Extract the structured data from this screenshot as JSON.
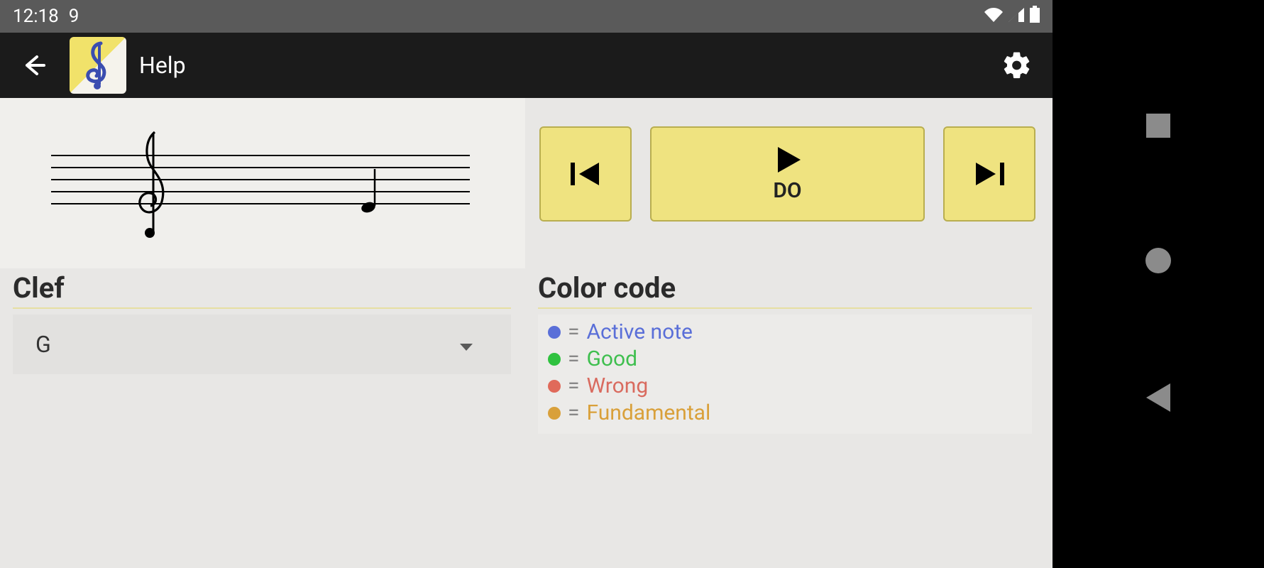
{
  "statusbar": {
    "time": "12:18",
    "extra": "9",
    "icons": [
      "wifi-icon",
      "signal-icon",
      "battery-icon"
    ]
  },
  "appbar": {
    "title": "Help"
  },
  "controls": {
    "play_label": "DO"
  },
  "clef_panel": {
    "title": "Clef",
    "selected": "G"
  },
  "color_panel": {
    "title": "Color code",
    "items": [
      {
        "color": "#5a6fd8",
        "label": "Active note",
        "cls": "active"
      },
      {
        "color": "#2fc23f",
        "label": "Good",
        "cls": "good"
      },
      {
        "color": "#e06a5a",
        "label": "Wrong",
        "cls": "wrong"
      },
      {
        "color": "#d9a03a",
        "label": "Fundamental",
        "cls": "fund"
      }
    ]
  }
}
